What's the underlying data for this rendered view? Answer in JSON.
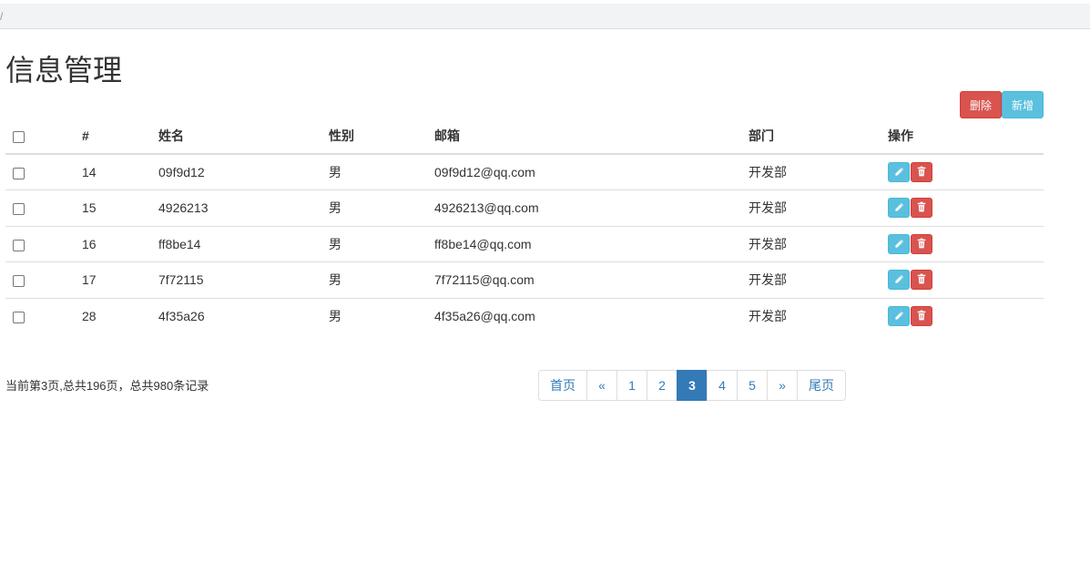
{
  "breadcrumb": {
    "separator": "/"
  },
  "page": {
    "title": "信息管理"
  },
  "toolbar": {
    "delete_label": "删除",
    "add_label": "新增"
  },
  "table": {
    "headers": {
      "id": "#",
      "name": "姓名",
      "gender": "性别",
      "email": "邮箱",
      "dept": "部门",
      "ops": "操作"
    },
    "rows": [
      {
        "id": "14",
        "name": "09f9d12",
        "gender": "男",
        "email": "09f9d12@qq.com",
        "dept": "开发部"
      },
      {
        "id": "15",
        "name": "4926213",
        "gender": "男",
        "email": "4926213@qq.com",
        "dept": "开发部"
      },
      {
        "id": "16",
        "name": "ff8be14",
        "gender": "男",
        "email": "ff8be14@qq.com",
        "dept": "开发部"
      },
      {
        "id": "17",
        "name": "7f72115",
        "gender": "男",
        "email": "7f72115@qq.com",
        "dept": "开发部"
      },
      {
        "id": "28",
        "name": "4f35a26",
        "gender": "男",
        "email": "4f35a26@qq.com",
        "dept": "开发部"
      }
    ],
    "row_icons": {
      "edit": "pencil-icon",
      "delete": "trash-icon"
    }
  },
  "pagination": {
    "info": "当前第3页,总共196页，总共980条记录",
    "first": "首页",
    "prev": "«",
    "pages": [
      "1",
      "2",
      "3",
      "4",
      "5"
    ],
    "current": "3",
    "next": "»",
    "last": "尾页"
  },
  "colors": {
    "danger": "#d9534f",
    "info": "#5bc0de",
    "primary": "#337ab7"
  }
}
